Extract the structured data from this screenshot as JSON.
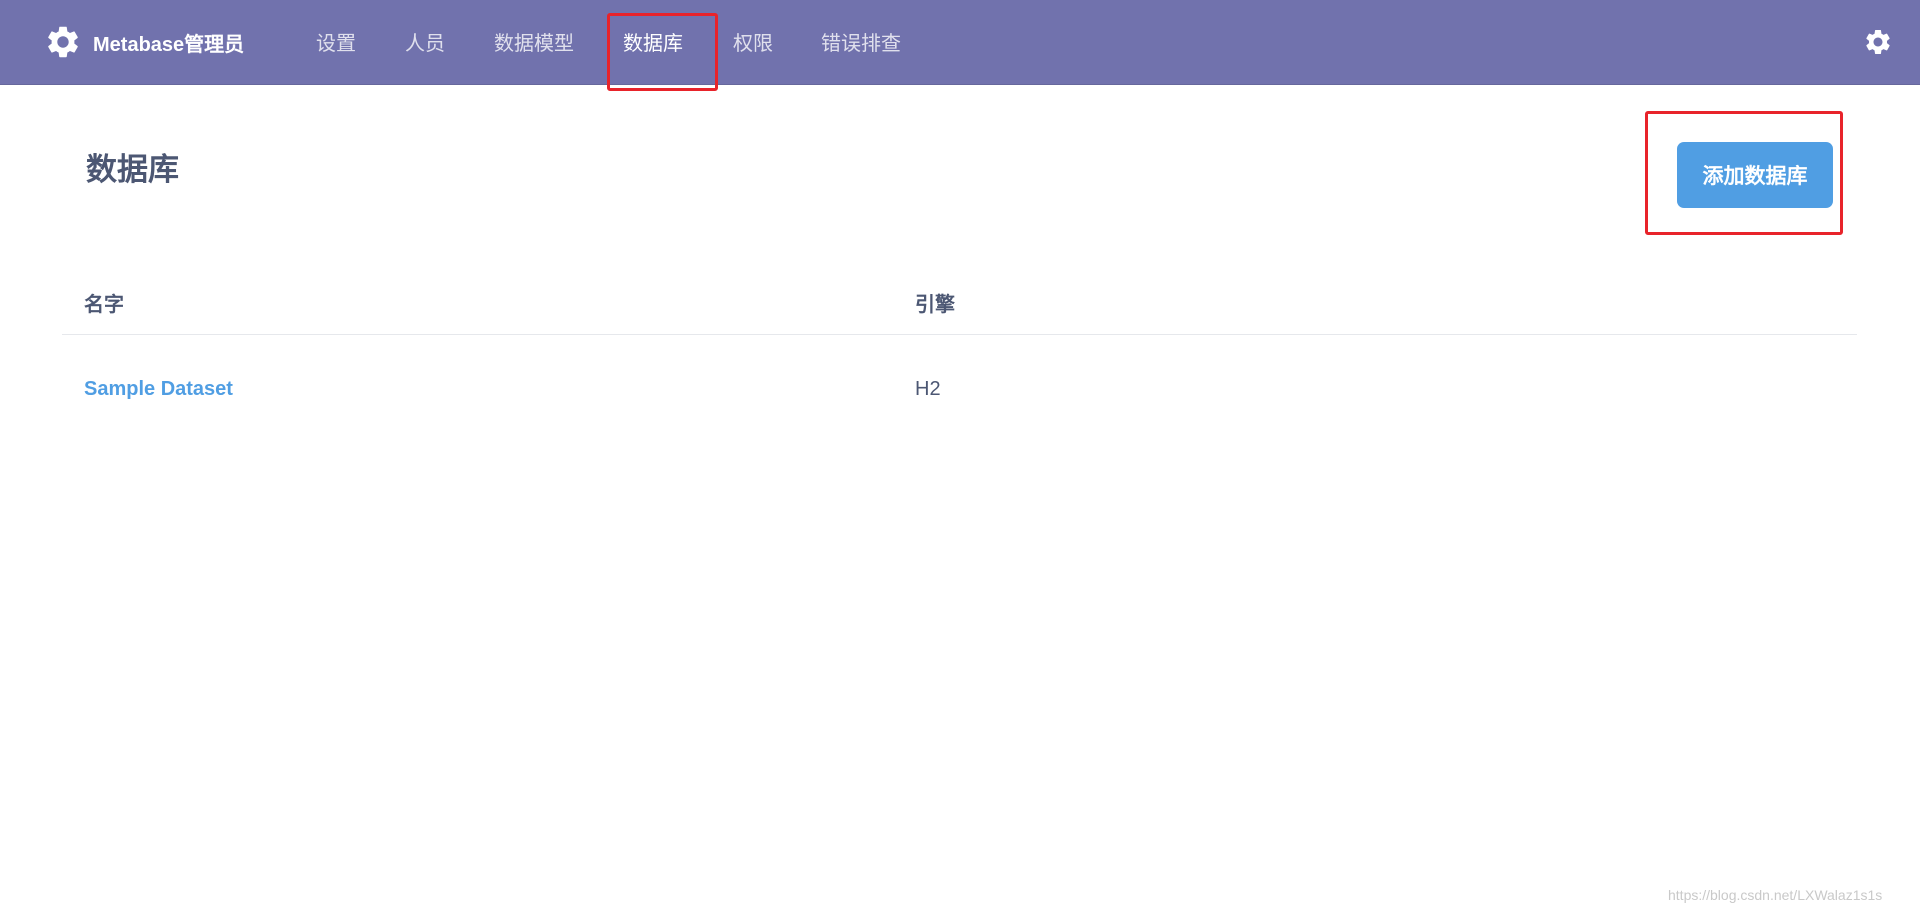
{
  "header": {
    "brand": "Metabase管理员",
    "brand_icon": "gear-icon",
    "nav": [
      {
        "label": "设置",
        "active": false
      },
      {
        "label": "人员",
        "active": false
      },
      {
        "label": "数据模型",
        "active": false
      },
      {
        "label": "数据库",
        "active": true
      },
      {
        "label": "权限",
        "active": false
      },
      {
        "label": "错误排查",
        "active": false
      }
    ],
    "settings_icon": "gear-icon",
    "background_color": "#7172ad"
  },
  "main": {
    "title": "数据库",
    "add_button_label": "添加数据库",
    "button_color": "#509ee3",
    "table": {
      "columns": [
        "名字",
        "引擎"
      ],
      "rows": [
        {
          "name": "Sample Dataset",
          "engine": "H2"
        }
      ]
    }
  },
  "annotation_color": "#e8232a",
  "watermark": "https://blog.csdn.net/LXWalaz1s1s"
}
